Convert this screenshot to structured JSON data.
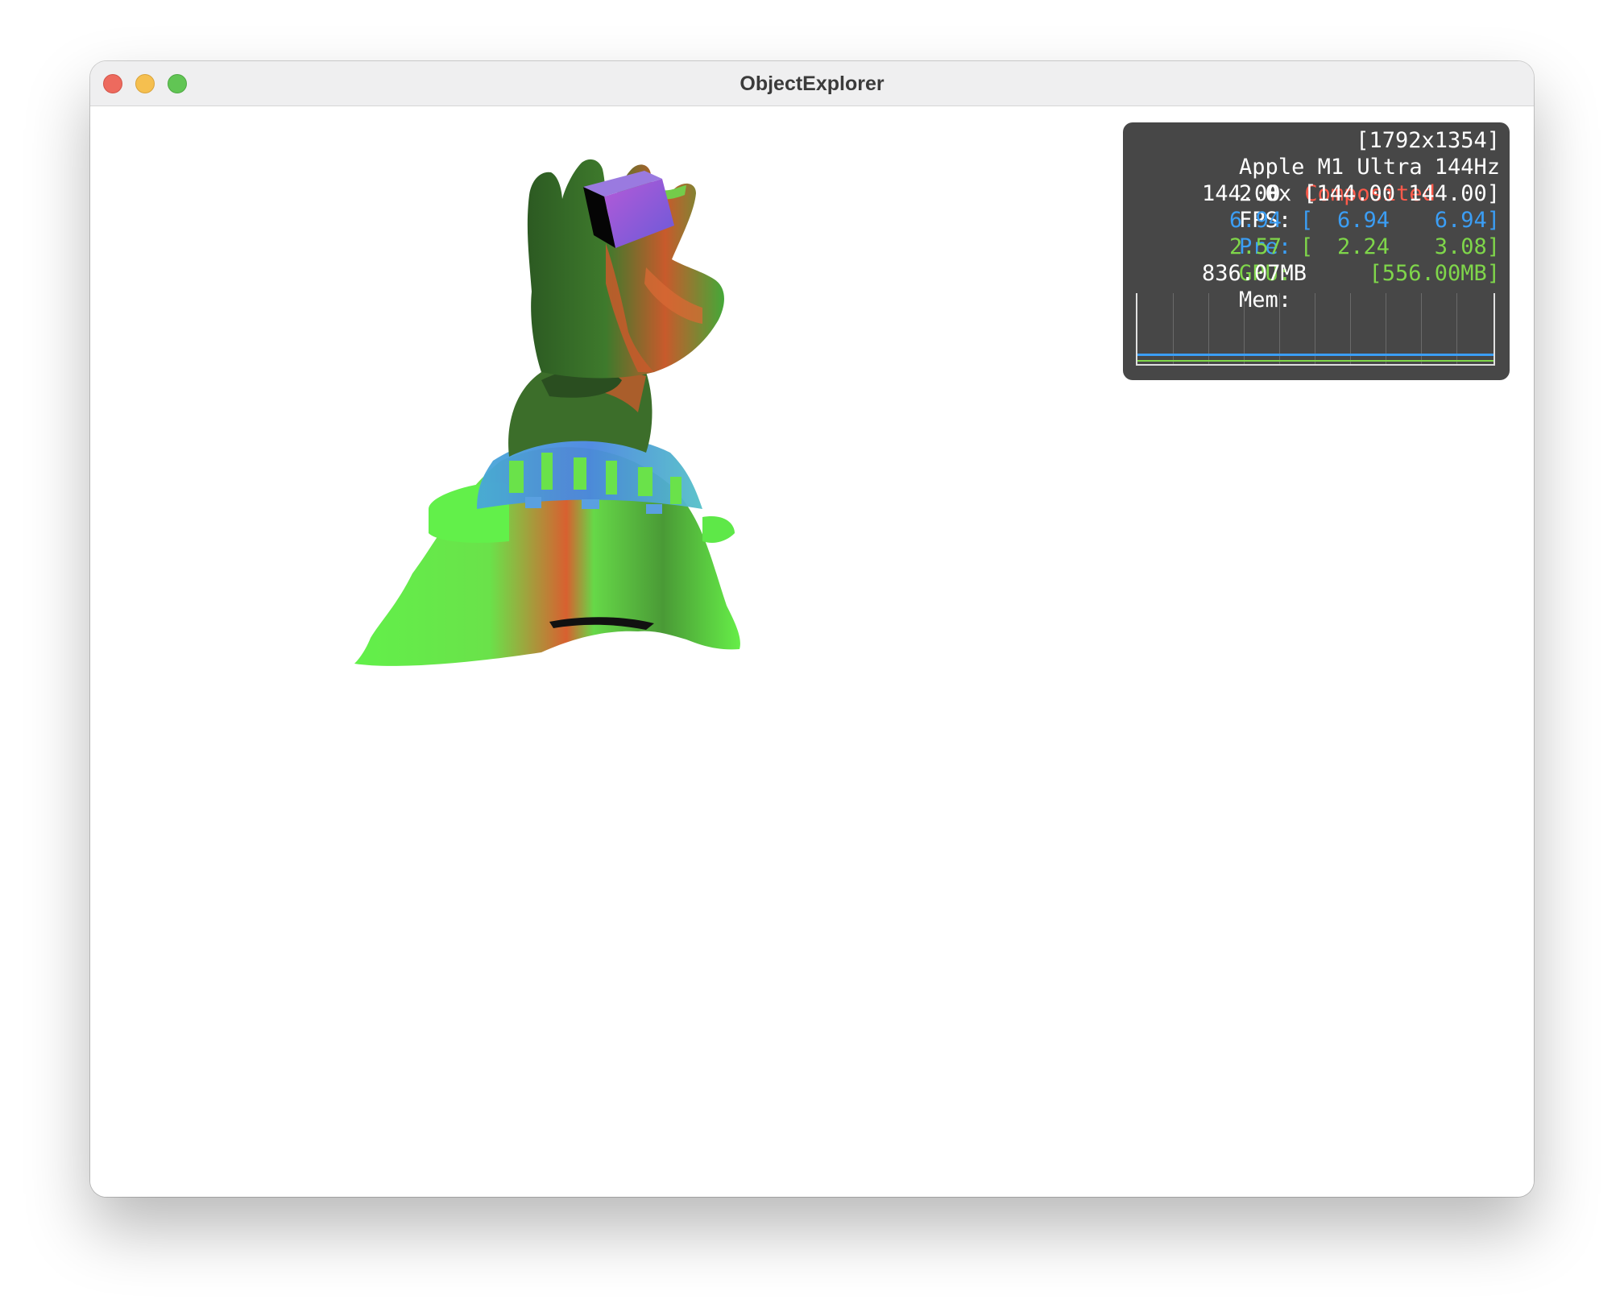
{
  "window": {
    "title": "ObjectExplorer"
  },
  "stats_overlay": {
    "gpu_name": "Apple M1 Ultra",
    "resolution": "[1792x1354]",
    "scale": "2.0x",
    "mode": "Composited",
    "refresh_rate": "144Hz",
    "fps_label": "FPS:",
    "fps_current": "144.00",
    "fps_range": "[144.00 144.00]",
    "pre_label": "Pre:",
    "pre_current": "6.94",
    "pre_bracket": "[",
    "pre_min": "6.94",
    "pre_max": "6.94]",
    "gpu_label": "GPU:",
    "gpu_current": "2.57",
    "gpu_bracket": "[",
    "gpu_min": "2.24",
    "gpu_max": "3.08]",
    "mem_label": "Mem:",
    "mem_current": "836.07MB",
    "mem_peak": "[556.00MB]",
    "colors": {
      "accent_red": "#ff5a4a",
      "pre_blue": "#3b9ef5",
      "gpu_green": "#7fd64a",
      "panel_bg": "#474747"
    }
  },
  "scene": {
    "description_icon": "3d-model-icon"
  }
}
